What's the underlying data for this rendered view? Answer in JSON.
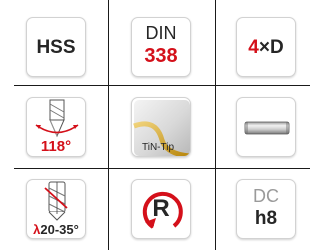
{
  "icons": {
    "r1c1": {
      "text": "HSS"
    },
    "r1c2": {
      "line1": "DIN",
      "line2": "338"
    },
    "r1c3": {
      "value": "4",
      "symbol": "×D"
    },
    "r2c1": {
      "angle": "118°",
      "icon": "point-angle-drill-icon"
    },
    "r2c2": {
      "label": "TiN-Tip",
      "icon": "coating-swatch-icon"
    },
    "r2c3": {
      "icon": "cylindrical-shank-icon"
    },
    "r3c1": {
      "lambda": "λ",
      "range": "20-35°",
      "icon": "helix-angle-drill-icon"
    },
    "r3c2": {
      "letter": "R",
      "icon": "right-hand-rotation-icon"
    },
    "r3c3": {
      "line1": "DC",
      "line2": "h8"
    }
  },
  "colors": {
    "red": "#d4101a",
    "dark": "#262626",
    "grey": "#9a9a9a",
    "gold": "#c9a227"
  }
}
